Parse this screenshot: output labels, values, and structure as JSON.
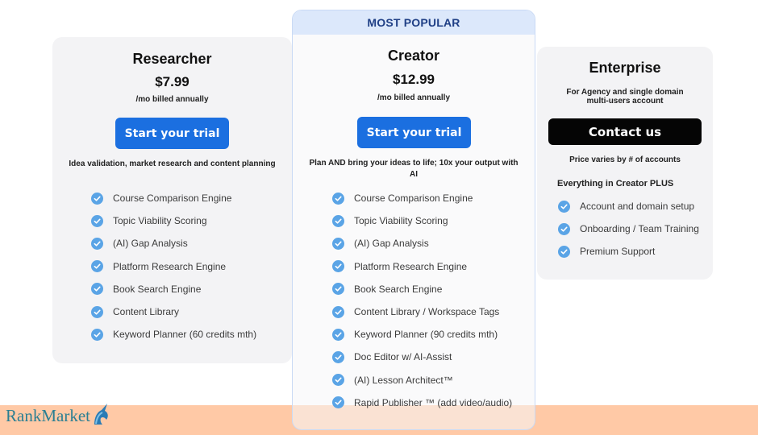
{
  "popular_label": "MOST POPULAR",
  "plans": [
    {
      "name": "Researcher",
      "price": "$7.99",
      "billing": "/mo billed annually",
      "cta": "Start your trial",
      "description": "Idea validation, market research and content planning",
      "features": [
        "Course Comparison Engine",
        "Topic Viability Scoring",
        "(AI) Gap Analysis",
        "Platform Research Engine",
        "Book Search Engine",
        "Content Library",
        "Keyword Planner (60 credits mth)"
      ]
    },
    {
      "name": "Creator",
      "price": "$12.99",
      "billing": "/mo billed annually",
      "cta": "Start your trial",
      "description": "Plan AND bring your ideas to life; 10x your output with AI",
      "features": [
        "Course Comparison Engine",
        "Topic Viability Scoring",
        "(AI) Gap Analysis",
        "Platform Research Engine",
        "Book Search Engine",
        "Content Library / Workspace Tags",
        "Keyword Planner (90 credits mth)",
        "Doc Editor w/ AI-Assist",
        "(AI) Lesson Architect™",
        "Rapid Publisher ™ (add video/audio)"
      ]
    },
    {
      "name": "Enterprise",
      "subtitle": "For Agency and single domain multi-users account",
      "cta": "Contact us",
      "price_note": "Price varies by # of accounts",
      "features_heading": "Everything in Creator PLUS",
      "features": [
        "Account and domain setup",
        "Onboarding / Team Training",
        "Premium Support"
      ]
    }
  ],
  "logo": {
    "rank": "Rank",
    "market": "Market"
  },
  "colors": {
    "primary_blue": "#1b6fe0",
    "check_blue": "#5aa4e6",
    "footer": "#ffc9a6"
  }
}
